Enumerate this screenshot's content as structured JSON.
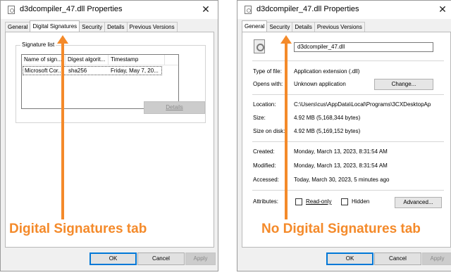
{
  "left_dialog": {
    "title": "d3dcompiler_47.dll Properties",
    "tabs": [
      "General",
      "Digital Signatures",
      "Security",
      "Details",
      "Previous Versions"
    ],
    "active_tab": "Digital Signatures",
    "signature_list": {
      "label": "Signature list",
      "columns": [
        "Name of sign...",
        "Digest algorit...",
        "Timestamp"
      ],
      "rows": [
        [
          "Microsoft Cor...",
          "sha256",
          "Friday, May 7, 20..."
        ]
      ]
    },
    "details_button": "Details",
    "ok": "OK",
    "cancel": "Cancel",
    "apply": "Apply"
  },
  "right_dialog": {
    "title": "d3dcompiler_47.dll Properties",
    "tabs": [
      "General",
      "Security",
      "Details",
      "Previous Versions"
    ],
    "active_tab": "General",
    "filename": "d3dcompiler_47.dll",
    "type_label": "Type of file:",
    "type_value": "Application extension (.dll)",
    "opens_label": "Opens with:",
    "opens_value": "Unknown application",
    "change_button": "Change...",
    "location_label": "Location:",
    "location_value": "C:\\Users\\cus\\AppData\\Local\\Programs\\3CXDesktopAp",
    "size_label": "Size:",
    "size_value": "4.92 MB (5,168,344 bytes)",
    "size_disk_label": "Size on disk:",
    "size_disk_value": "4.92 MB (5,169,152 bytes)",
    "created_label": "Created:",
    "created_value": "Monday, March 13, 2023, 8:31:54 AM",
    "modified_label": "Modified:",
    "modified_value": "Monday, March 13, 2023, 8:31:54 AM",
    "accessed_label": "Accessed:",
    "accessed_value": "Today, March 30, 2023, 5 minutes ago",
    "attributes_label": "Attributes:",
    "readonly_label": "Read-only",
    "hidden_label": "Hidden",
    "advanced_button": "Advanced...",
    "ok": "OK",
    "cancel": "Cancel",
    "apply": "Apply"
  },
  "captions": {
    "left": "Digital Signatures tab",
    "right": "No Digital Signatures tab"
  },
  "colors": {
    "annotation": "#f48a2a",
    "focus_border": "#0078d7"
  }
}
